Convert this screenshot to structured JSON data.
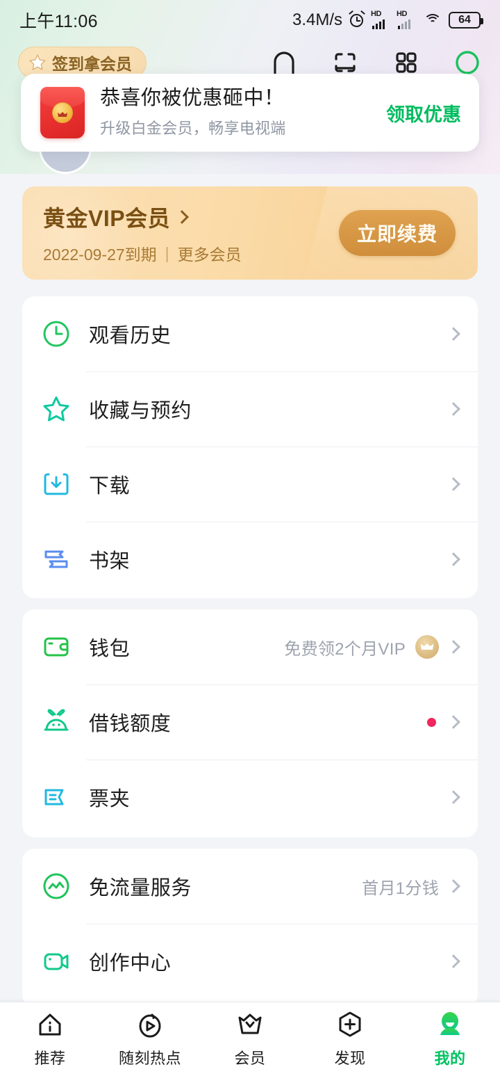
{
  "status_bar": {
    "time": "上午11:06",
    "net_speed": "3.4M/s",
    "alarm_icon": "alarm-clock-icon",
    "sim1_label": "HD",
    "sim2_label": "HD",
    "wifi_icon": "wifi-icon",
    "battery_level": "64"
  },
  "header": {
    "signin_label": "签到拿会员",
    "signin_icon": "star-icon",
    "icons": [
      {
        "name": "cast-icon"
      },
      {
        "name": "scan-card-icon"
      },
      {
        "name": "grid-apps-icon"
      },
      {
        "name": "avatar-ring-icon"
      }
    ]
  },
  "promo_card": {
    "icon": "red-envelope-icon",
    "title": "恭喜你被优惠砸中！",
    "subtitle": "升级白金会员，畅享电视端",
    "action_label": "领取优惠",
    "action_color": "#00bc5f"
  },
  "vip_banner": {
    "title": "黄金VIP会员",
    "chevron_icon": "chevron-right-icon",
    "expiry": "2022-09-27到期",
    "divider": "|",
    "more_label": "更多会员",
    "button_label": "立即续费",
    "bg_color": "#fbdcaa",
    "button_color": "#cf8e3b"
  },
  "menu_groups": [
    {
      "name": "library-group",
      "rows": [
        {
          "icon": "clock-history-icon",
          "icon_color": "#22c55e",
          "label": "观看历史",
          "extra": "",
          "badge": "none"
        },
        {
          "icon": "star-outline-icon",
          "icon_color": "#10c9a0",
          "label": "收藏与预约",
          "extra": "",
          "badge": "none"
        },
        {
          "icon": "download-icon",
          "icon_color": "#22b8e0",
          "label": "下载",
          "extra": "",
          "badge": "none"
        },
        {
          "icon": "bookshelf-icon",
          "icon_color": "#5b8def",
          "label": "书架",
          "extra": "",
          "badge": "none"
        }
      ]
    },
    {
      "name": "finance-group",
      "rows": [
        {
          "icon": "wallet-icon",
          "icon_color": "#24c24a",
          "label": "钱包",
          "extra": "免费领2个月VIP",
          "badge": "vip-crown"
        },
        {
          "icon": "money-bag-icon",
          "icon_color": "#12c98a",
          "label": "借钱额度",
          "extra": "",
          "badge": "red-dot"
        },
        {
          "icon": "ticket-icon",
          "icon_color": "#22b8e0",
          "label": "票夹",
          "extra": "",
          "badge": "none"
        }
      ]
    },
    {
      "name": "services-group",
      "rows": [
        {
          "icon": "free-data-icon",
          "icon_color": "#1ec35a",
          "label": "免流量服务",
          "extra": "首月1分钱",
          "badge": "none"
        },
        {
          "icon": "creator-camera-icon",
          "icon_color": "#12c98a",
          "label": "创作中心",
          "extra": "",
          "badge": "none"
        }
      ]
    }
  ],
  "bottom_nav": {
    "active_color": "#00c25f",
    "items": [
      {
        "icon": "home-icon",
        "label": "推荐",
        "active": false
      },
      {
        "icon": "play-hot-icon",
        "label": "随刻热点",
        "active": false
      },
      {
        "icon": "crown-icon",
        "label": "会员",
        "active": false
      },
      {
        "icon": "plus-hex-icon",
        "label": "发现",
        "active": false
      },
      {
        "icon": "person-icon",
        "label": "我的",
        "active": true
      }
    ]
  }
}
